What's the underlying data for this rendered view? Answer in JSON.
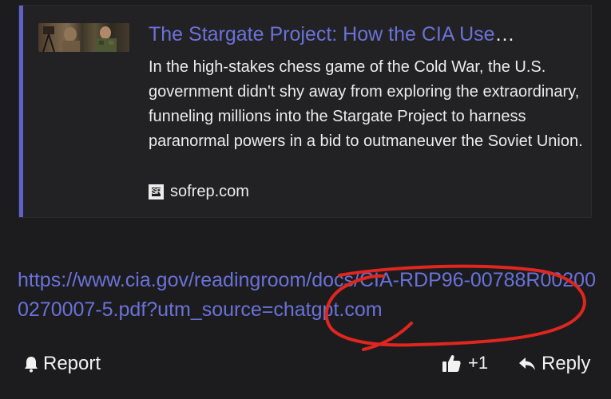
{
  "preview": {
    "title": "The Stargate Project: How the CIA Use",
    "title_ellipsis": "…",
    "description": "In the high-stakes chess game of the Cold War, the U.S. government didn't shy away from exploring the extraordinary, funneling millions into the Stargate Project to harness paranormal powers in a bid to outmaneuver the Soviet Union.",
    "site": "sofrep.com",
    "favicon_text": "SR",
    "accent_color": "#5c63c9"
  },
  "post": {
    "link": "https://www.cia.gov/readingroom/docs/CIA-RDP96-00788R002000270007-5.pdf?utm_source=chatgpt.com",
    "link_color": "#6a72d8",
    "annotation_color": "#e0261f"
  },
  "actions": {
    "report_label": "Report",
    "like_count": "+1",
    "reply_label": "Reply"
  }
}
